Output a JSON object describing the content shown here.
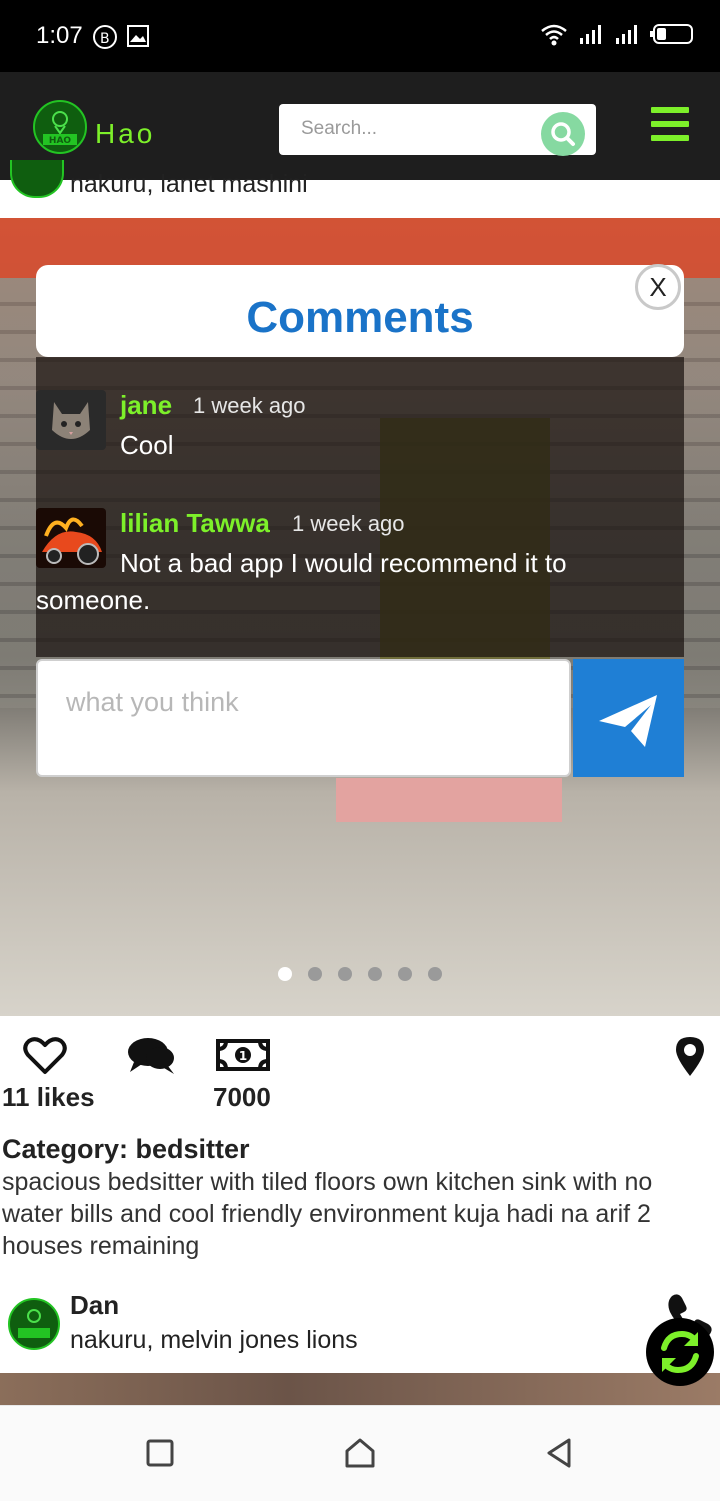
{
  "status_bar": {
    "time": "1:07"
  },
  "header": {
    "brand": "Hao",
    "logo_text": "HAO",
    "search_placeholder": "Search..."
  },
  "prev_post": {
    "location": "nakuru, lanet mashini"
  },
  "comments_modal": {
    "title": "Comments",
    "close_label": "X",
    "comments": [
      {
        "name": "jane",
        "time": "1 week ago",
        "text": "Cool"
      },
      {
        "name": "lilian Tawwa",
        "time": "1 week ago",
        "text_line1": "Not a bad app I would recommend it to",
        "text_line2": "someone."
      }
    ],
    "input_placeholder": "what you think"
  },
  "carousel": {
    "total": 6,
    "active": 1
  },
  "post": {
    "likes": "11 likes",
    "price": "7000",
    "category": "Category: bedsitter",
    "description": "spacious bedsitter with tiled floors own kitchen sink with no water bills and cool friendly environment kuja hadi na arif 2 houses remaining"
  },
  "next_post": {
    "name": "Dan",
    "location": "nakuru, melvin jones lions"
  },
  "icons": {
    "heart": "heart-icon",
    "comment": "comment-icon",
    "money": "money-icon",
    "location": "map-pin-icon",
    "phone": "phone-icon",
    "refresh": "refresh-icon",
    "send": "send-icon",
    "search": "search-icon",
    "menu": "menu-icon"
  },
  "colors": {
    "accent_green": "#7df02a",
    "title_blue": "#1a73c8",
    "send_blue": "#1f7fd5"
  }
}
